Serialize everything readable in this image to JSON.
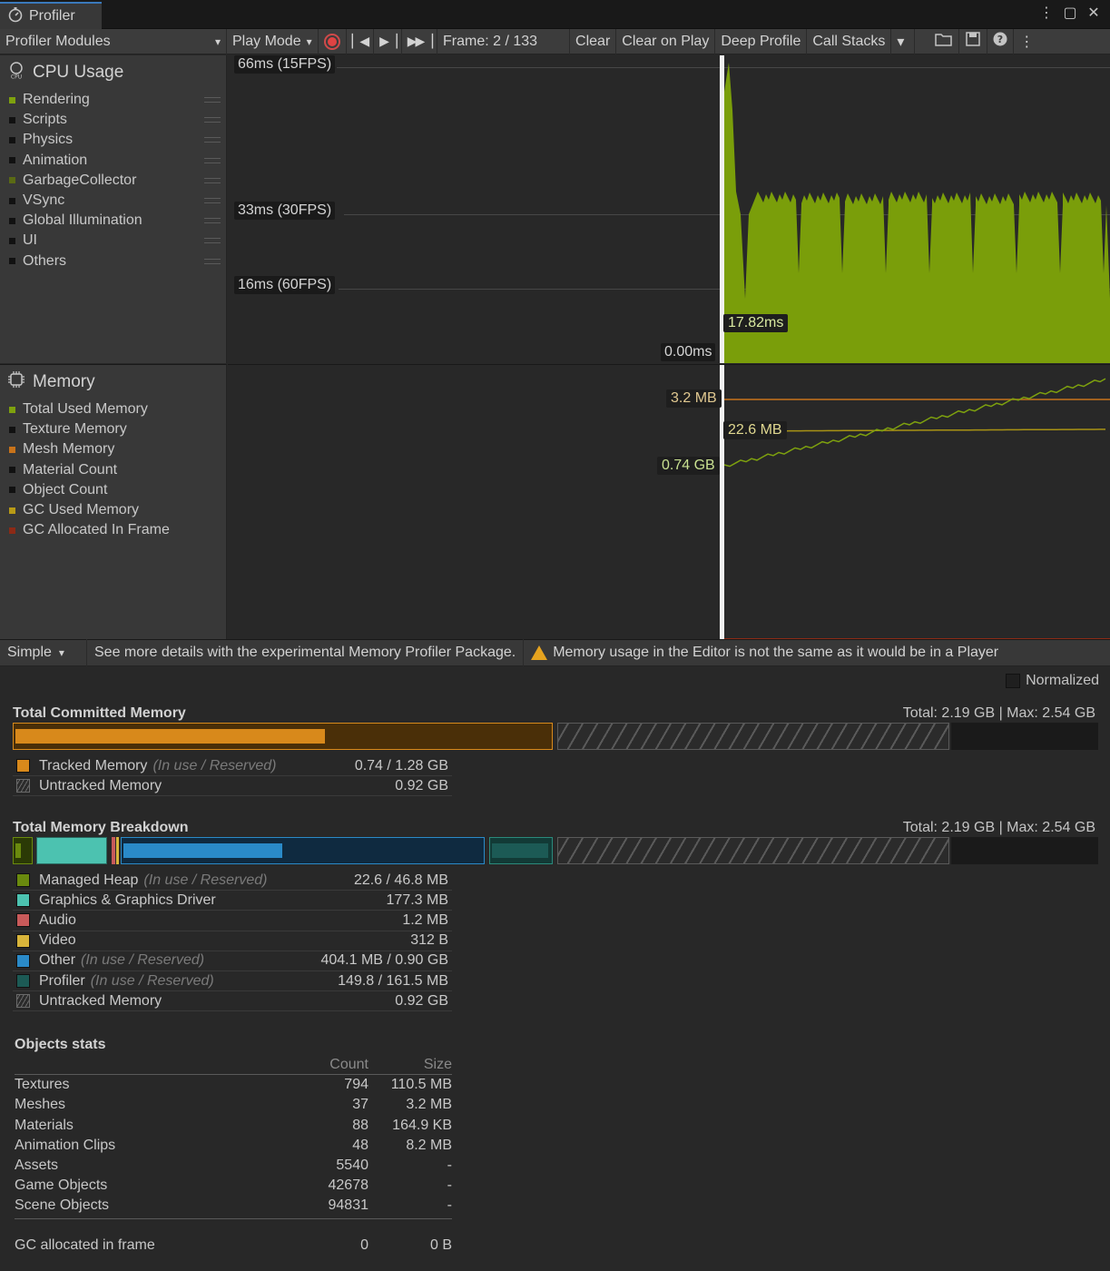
{
  "window": {
    "tab_title": "Profiler",
    "icons": [
      "kebab-menu-icon",
      "maximize-icon",
      "close-icon"
    ]
  },
  "toolbar": {
    "modules_label": "Profiler Modules",
    "play_mode_label": "Play Mode",
    "frame_label": "Frame: 2 / 133",
    "clear_label": "Clear",
    "clear_on_play_label": "Clear on Play",
    "deep_profile_label": "Deep Profile",
    "call_stacks_label": "Call Stacks"
  },
  "cpu_module": {
    "title": "CPU Usage",
    "legend": [
      {
        "label": "Rendering",
        "color": "#7ea10e"
      },
      {
        "label": "Scripts",
        "color": "#111111"
      },
      {
        "label": "Physics",
        "color": "#111111"
      },
      {
        "label": "Animation",
        "color": "#111111"
      },
      {
        "label": "GarbageCollector",
        "color": "#5a6a14"
      },
      {
        "label": "VSync",
        "color": "#111111"
      },
      {
        "label": "Global Illumination",
        "color": "#111111"
      },
      {
        "label": "UI",
        "color": "#111111"
      },
      {
        "label": "Others",
        "color": "#111111"
      }
    ],
    "axis_labels": {
      "fps15": "66ms (15FPS)",
      "fps30": "33ms (30FPS)",
      "fps60": "16ms (60FPS)",
      "zero": "0.00ms",
      "current": "17.82ms"
    }
  },
  "memory_module": {
    "title": "Memory",
    "legend": [
      {
        "label": "Total Used Memory",
        "color": "#7ea10e"
      },
      {
        "label": "Texture Memory",
        "color": "#111111"
      },
      {
        "label": "Mesh Memory",
        "color": "#c8731a"
      },
      {
        "label": "Material Count",
        "color": "#111111"
      },
      {
        "label": "Object Count",
        "color": "#111111"
      },
      {
        "label": "GC Used Memory",
        "color": "#b89a16"
      },
      {
        "label": "GC Allocated In Frame",
        "color": "#8c2a16"
      }
    ],
    "value_labels": {
      "mesh": "3.2 MB",
      "gc": "22.6 MB",
      "total": "0.74 GB"
    }
  },
  "subbar": {
    "view_mode": "Simple",
    "package_hint": "See more details with the experimental Memory Profiler Package.",
    "warning": "Memory usage in the Editor is not the same as it would be in a Player"
  },
  "normalized_label": "Normalized",
  "committed": {
    "title": "Total Committed Memory",
    "total_label": "Total: 2.19 GB | Max: 2.54 GB",
    "rows": [
      {
        "name": "Tracked Memory",
        "note": "(In use / Reserved)",
        "value": "0.74 / 1.28 GB",
        "color": "#d8891b"
      },
      {
        "name": "Untracked Memory",
        "note": "",
        "value": "0.92 GB",
        "color": "hatch"
      }
    ]
  },
  "breakdown": {
    "title": "Total Memory Breakdown",
    "total_label": "Total: 2.19 GB | Max: 2.54 GB",
    "rows": [
      {
        "name": "Managed Heap",
        "note": "(In use / Reserved)",
        "value": "22.6 / 46.8 MB",
        "color": "#6a8a0e"
      },
      {
        "name": "Graphics & Graphics Driver",
        "note": "",
        "value": "177.3 MB",
        "color": "#4cc2b0"
      },
      {
        "name": "Audio",
        "note": "",
        "value": "1.2 MB",
        "color": "#c85a5a"
      },
      {
        "name": "Video",
        "note": "",
        "value": "312 B",
        "color": "#d8b43a"
      },
      {
        "name": "Other",
        "note": "(In use / Reserved)",
        "value": "404.1 MB / 0.90 GB",
        "color": "#2a8ac8"
      },
      {
        "name": "Profiler",
        "note": "(In use / Reserved)",
        "value": "149.8 / 161.5 MB",
        "color": "#1c5a55"
      },
      {
        "name": "Untracked Memory",
        "note": "",
        "value": "0.92 GB",
        "color": "hatch"
      }
    ]
  },
  "objects": {
    "title": "Objects stats",
    "headers": [
      "",
      "Count",
      "Size"
    ],
    "rows": [
      [
        "Textures",
        "794",
        "110.5 MB"
      ],
      [
        "Meshes",
        "37",
        "3.2 MB"
      ],
      [
        "Materials",
        "88",
        "164.9 KB"
      ],
      [
        "Animation Clips",
        "48",
        "8.2 MB"
      ],
      [
        "Assets",
        "5540",
        "-"
      ],
      [
        "Game Objects",
        "42678",
        "-"
      ],
      [
        "Scene Objects",
        "94831",
        "-"
      ]
    ],
    "gc_row": [
      "GC allocated in frame",
      "0",
      "0 B"
    ]
  }
}
